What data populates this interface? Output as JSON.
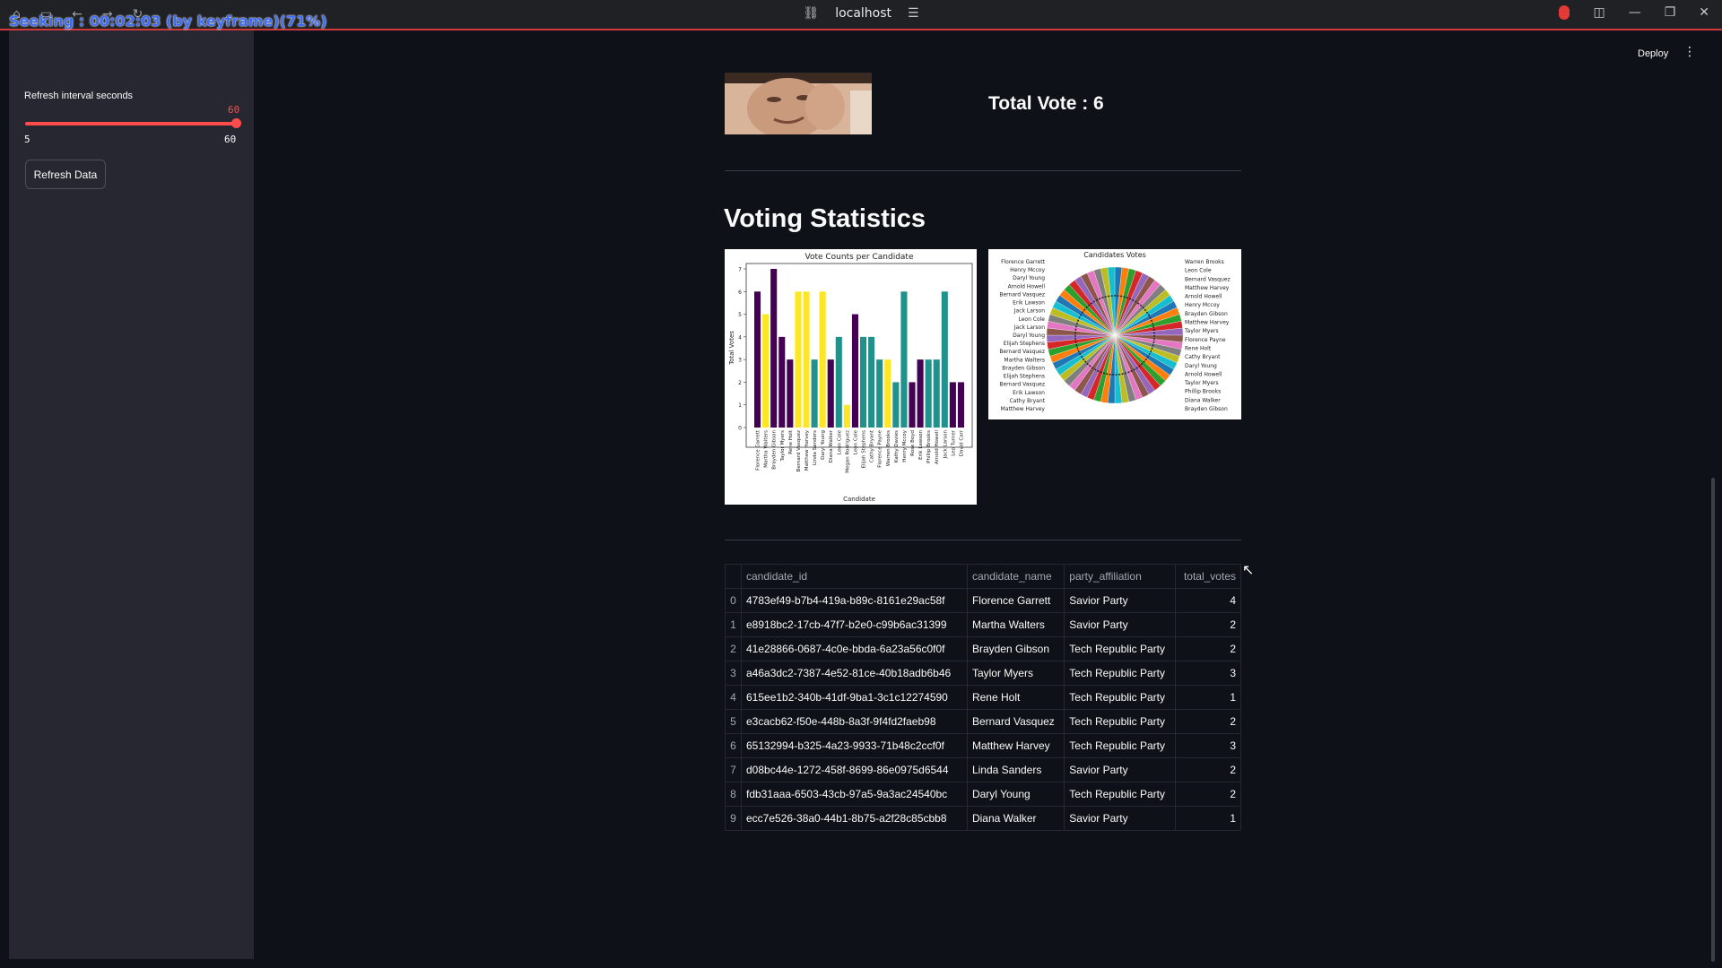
{
  "overlay": {
    "seek_text": "Seeking : 00:02:03 (by keyframe)(71%)"
  },
  "browser": {
    "url": "localhost"
  },
  "sidebar": {
    "slider": {
      "label": "Refresh interval seconds",
      "value": "60",
      "min": "5",
      "max": "60",
      "fraction": 1.0
    },
    "refresh_button": "Refresh Data"
  },
  "header": {
    "deploy_label": "Deploy"
  },
  "main": {
    "total_vote": "Total Vote : 6",
    "section_title": "Voting Statistics"
  },
  "chart_data": [
    {
      "type": "bar",
      "title": "Vote Counts per Candidate",
      "xlabel": "Candidate",
      "ylabel": "Total Votes",
      "ylim": [
        0,
        7
      ],
      "yticks": [
        0,
        1,
        2,
        3,
        4,
        5,
        6,
        7
      ],
      "categories": [
        "Florence Garrett",
        "Martha Walters",
        "Brayden Gibson",
        "Taylor Myers",
        "Rene Holt",
        "Bernard Vasquez",
        "Matthew Harvey",
        "Linda Sanders",
        "Daryl Young",
        "Diana Walker",
        "Leon Cole",
        "Megan Rodriguez",
        "Leon Cole",
        "Elijah Stephens",
        "Cathy Bryant",
        "Florence Payne",
        "Warren Brooks",
        "Kathy Davies",
        "Henry Mccoy",
        "Rose Boyd",
        "Erik Lawson",
        "Phillip Brooks",
        "Arnold Howell",
        "Jack Larson",
        "Leo Turner",
        "David Carr"
      ],
      "values": [
        6,
        5,
        7,
        4,
        3,
        6,
        6,
        3,
        6,
        3,
        4,
        1,
        5,
        4,
        4,
        3,
        3,
        2,
        6,
        2,
        3,
        3,
        3,
        6,
        2,
        2
      ],
      "colors": [
        "#440154",
        "#fde725",
        "#440154",
        "#440154",
        "#440154",
        "#fde725",
        "#fde725",
        "#21918c",
        "#fde725",
        "#440154",
        "#21918c",
        "#fde725",
        "#440154",
        "#21918c",
        "#21918c",
        "#21918c",
        "#fde725",
        "#21918c",
        "#21918c",
        "#440154",
        "#440154",
        "#21918c",
        "#21918c",
        "#21918c",
        "#440154",
        "#440154"
      ]
    },
    {
      "type": "pie",
      "title": "Candidates Votes",
      "slice_count": 60,
      "labels_left": [
        "Florence Garrett",
        "Henry Mccoy",
        "Daryl Young",
        "Arnold Howell",
        "Bernard Vasquez",
        "Erik Lawson",
        "Jack Larson",
        "Leon Cole",
        "Jack Larson",
        "Daryl Young",
        "Elijah Stephens",
        "Bernard Vasquez",
        "Martha Walters",
        "Brayden Gibson",
        "Elijah Stephens",
        "Bernard Vasquez",
        "Erik Lawson",
        "Cathy Bryant",
        "Matthew Harvey"
      ],
      "labels_right": [
        "Warren Brooks",
        "Leon Cole",
        "Bernard Vasquez",
        "Matthew Harvey",
        "Arnold Howell",
        "Henry Mccoy",
        "Brayden Gibson",
        "Matthew Harvey",
        "Taylor Myers",
        "Florence Payne",
        "Rene Holt",
        "Cathy Bryant",
        "Daryl Young",
        "Arnold Howell",
        "Taylor Myers",
        "Phillip Brooks",
        "Diana Walker",
        "Brayden Gibson"
      ]
    }
  ],
  "table": {
    "columns": [
      "candidate_id",
      "candidate_name",
      "party_affiliation",
      "total_votes"
    ],
    "rows": [
      {
        "index": "0",
        "candidate_id": "4783ef49-b7b4-419a-b89c-8161e29ac58f",
        "candidate_name": "Florence Garrett",
        "party_affiliation": "Savior Party",
        "total_votes": "4"
      },
      {
        "index": "1",
        "candidate_id": "e8918bc2-17cb-47f7-b2e0-c99b6ac31399",
        "candidate_name": "Martha Walters",
        "party_affiliation": "Savior Party",
        "total_votes": "2"
      },
      {
        "index": "2",
        "candidate_id": "41e28866-0687-4c0e-bbda-6a23a56c0f0f",
        "candidate_name": "Brayden Gibson",
        "party_affiliation": "Tech Republic Party",
        "total_votes": "2"
      },
      {
        "index": "3",
        "candidate_id": "a46a3dc2-7387-4e52-81ce-40b18adb6b46",
        "candidate_name": "Taylor Myers",
        "party_affiliation": "Tech Republic Party",
        "total_votes": "3"
      },
      {
        "index": "4",
        "candidate_id": "615ee1b2-340b-41df-9ba1-3c1c12274590",
        "candidate_name": "Rene Holt",
        "party_affiliation": "Tech Republic Party",
        "total_votes": "1"
      },
      {
        "index": "5",
        "candidate_id": "e3cacb62-f50e-448b-8a3f-9f4fd2faeb98",
        "candidate_name": "Bernard Vasquez",
        "party_affiliation": "Tech Republic Party",
        "total_votes": "2"
      },
      {
        "index": "6",
        "candidate_id": "65132994-b325-4a23-9933-71b48c2ccf0f",
        "candidate_name": "Matthew Harvey",
        "party_affiliation": "Tech Republic Party",
        "total_votes": "3"
      },
      {
        "index": "7",
        "candidate_id": "d08bc44e-1272-458f-8699-86e0975d6544",
        "candidate_name": "Linda Sanders",
        "party_affiliation": "Savior Party",
        "total_votes": "2"
      },
      {
        "index": "8",
        "candidate_id": "fdb31aaa-6503-43cb-97a5-9a3ac24540bc",
        "candidate_name": "Daryl Young",
        "party_affiliation": "Tech Republic Party",
        "total_votes": "2"
      },
      {
        "index": "9",
        "candidate_id": "ecc7e526-38a0-44b1-8b75-a2f28c85cbb8",
        "candidate_name": "Diana Walker",
        "party_affiliation": "Savior Party",
        "total_votes": "1"
      }
    ]
  },
  "icons": {
    "link": "link-icon",
    "tune": "tune-icon",
    "record": "record-icon",
    "sidebar": "sidebar-toggle-icon",
    "minimize": "minimize-icon",
    "maximize": "maximize-icon",
    "close": "close-icon",
    "more": "more-vert-icon"
  }
}
